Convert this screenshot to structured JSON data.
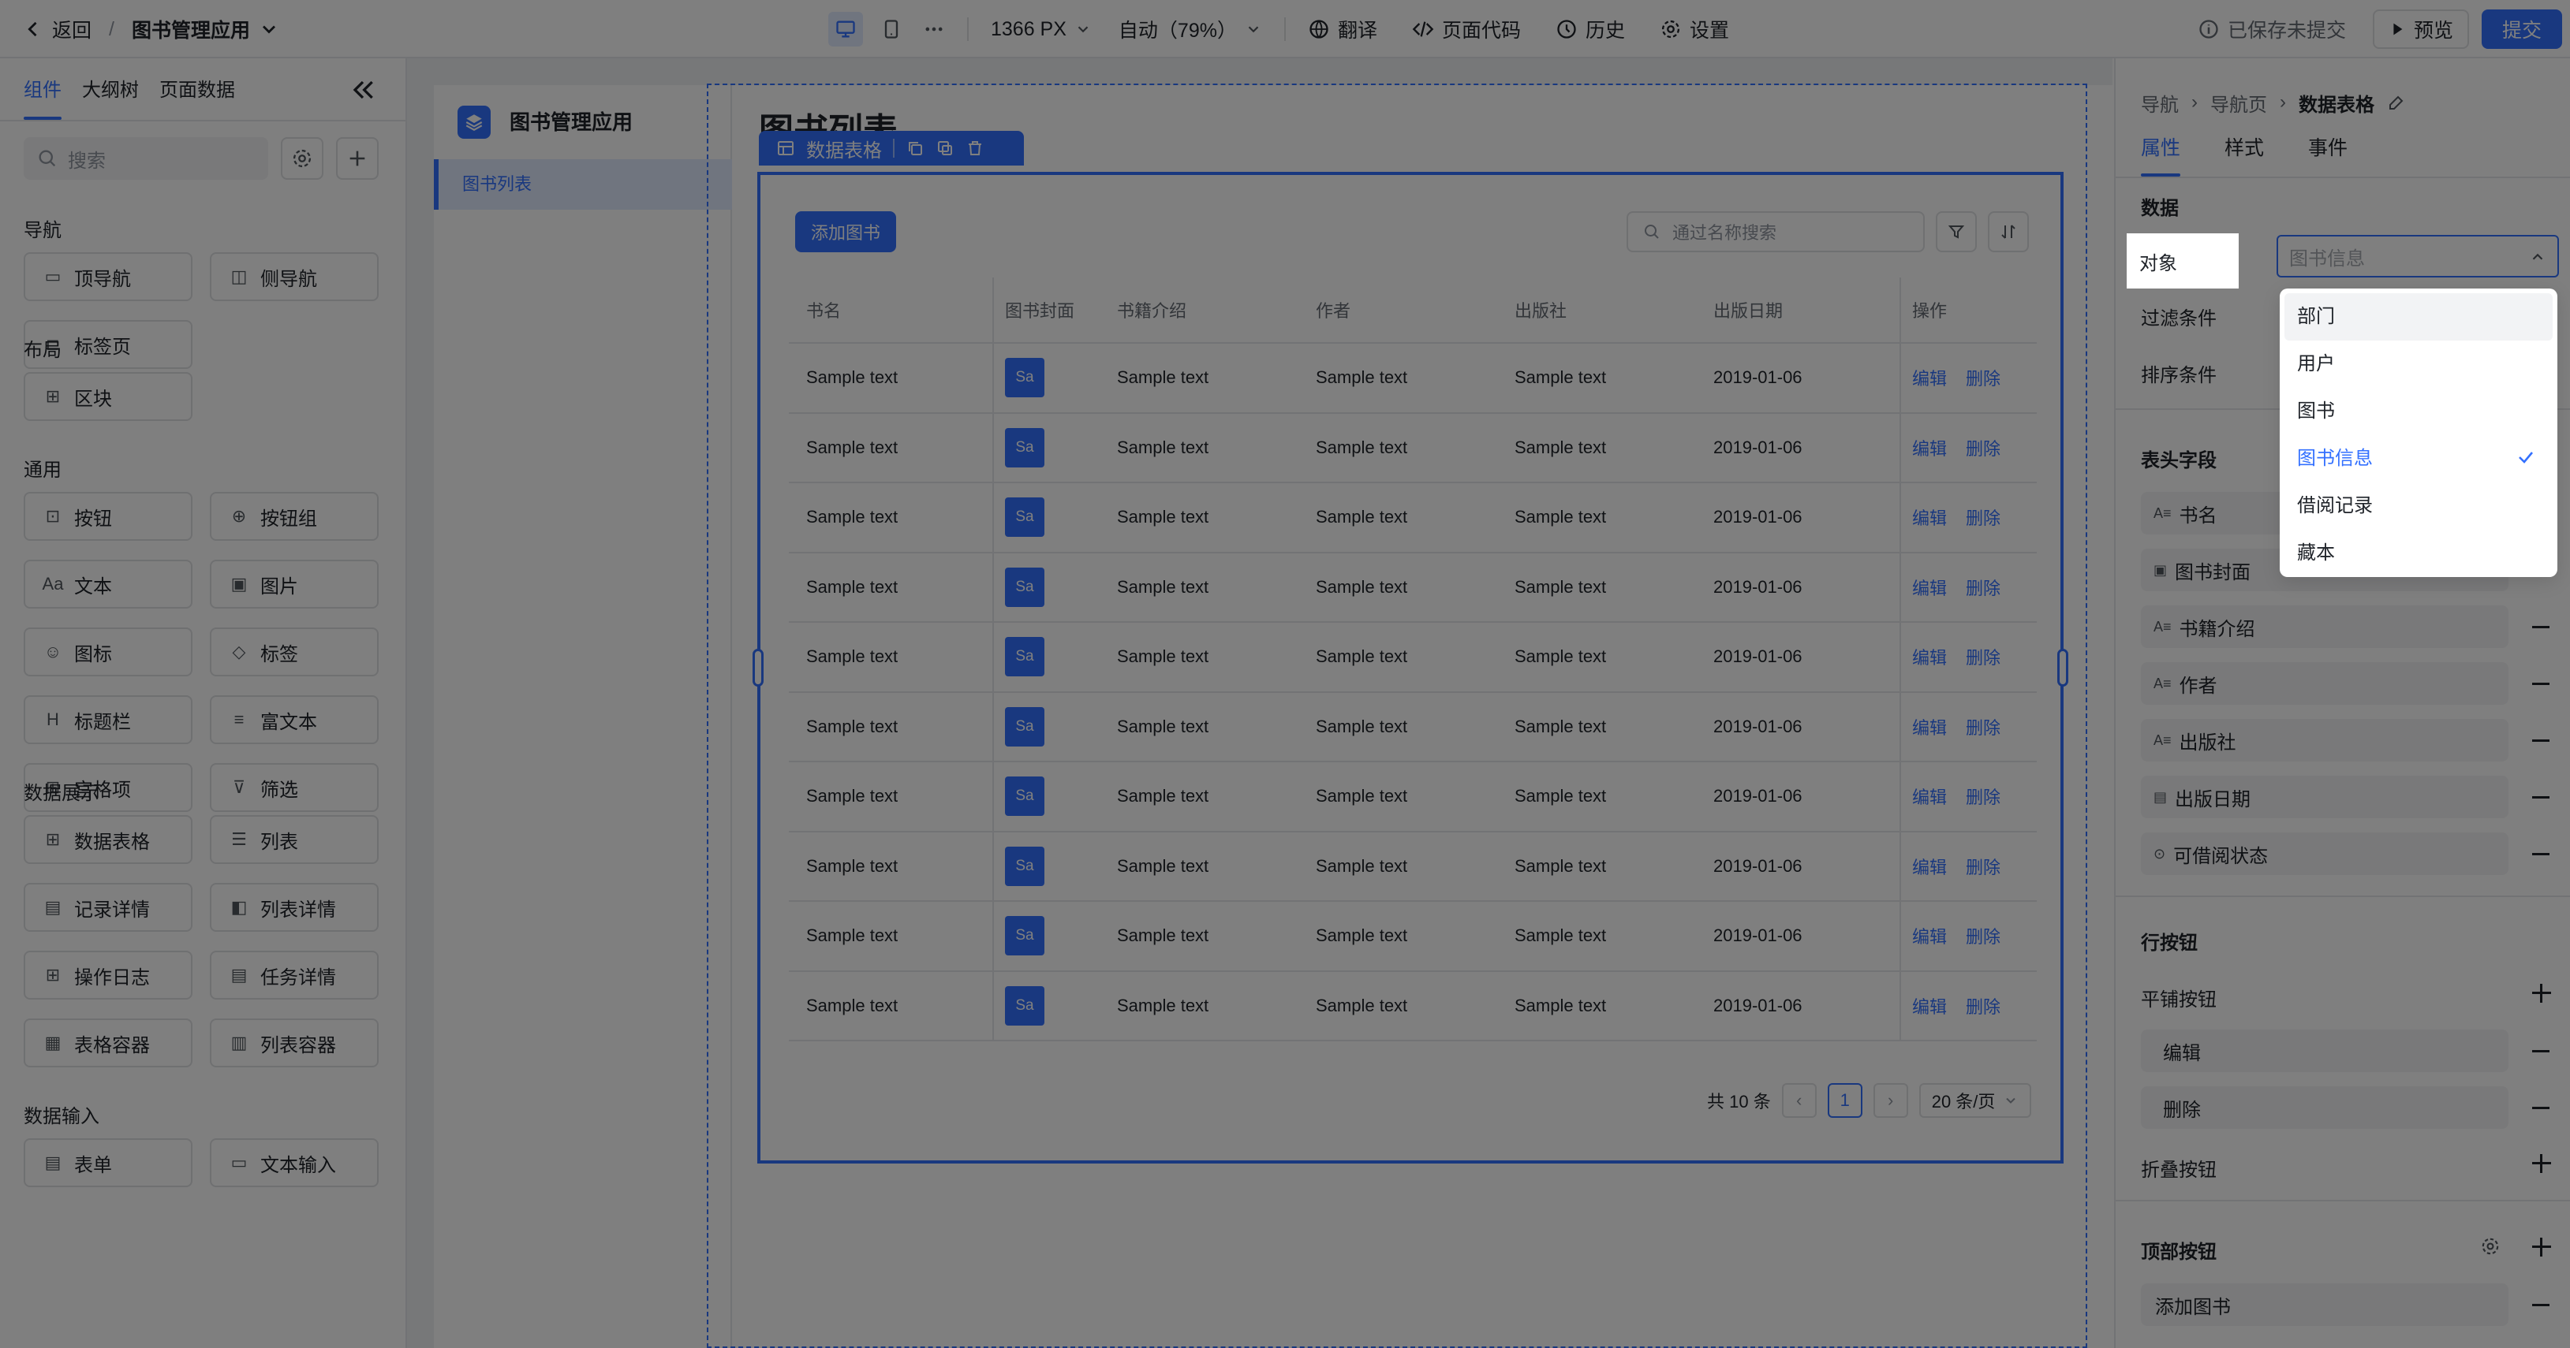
{
  "topbar": {
    "back_label": "返回",
    "app_name": "图书管理应用",
    "resolution": "1366 PX",
    "zoom": "自动（79%）",
    "translate": "翻译",
    "page_code": "页面代码",
    "history": "历史",
    "settings": "设置",
    "save_status": "已保存未提交",
    "preview": "预览",
    "submit": "提交"
  },
  "left_panel": {
    "tabs": [
      "组件",
      "大纲树",
      "页面数据"
    ],
    "search_placeholder": "搜索",
    "sections": [
      {
        "title": "导航",
        "items": [
          {
            "label": "顶导航",
            "icon": "top-nav-icon"
          },
          {
            "label": "侧导航",
            "icon": "side-nav-icon"
          },
          {
            "label": "标签页",
            "icon": "tabs-icon"
          }
        ]
      },
      {
        "title": "布局",
        "items": [
          {
            "label": "区块",
            "icon": "block-icon"
          }
        ]
      },
      {
        "title": "通用",
        "items": [
          {
            "label": "按钮",
            "icon": "button-icon"
          },
          {
            "label": "按钮组",
            "icon": "button-group-icon"
          },
          {
            "label": "文本",
            "icon": "text-icon"
          },
          {
            "label": "图片",
            "icon": "image-icon"
          },
          {
            "label": "图标",
            "icon": "smile-icon"
          },
          {
            "label": "标签",
            "icon": "tag-icon"
          },
          {
            "label": "标题栏",
            "icon": "heading-icon"
          },
          {
            "label": "富文本",
            "icon": "rich-text-icon"
          },
          {
            "label": "宫格项",
            "icon": "grid-item-icon"
          },
          {
            "label": "筛选",
            "icon": "filter-icon"
          }
        ]
      },
      {
        "title": "数据展示",
        "items": [
          {
            "label": "数据表格",
            "icon": "data-table-icon"
          },
          {
            "label": "列表",
            "icon": "list-icon"
          },
          {
            "label": "记录详情",
            "icon": "record-detail-icon"
          },
          {
            "label": "列表详情",
            "icon": "list-detail-icon"
          },
          {
            "label": "操作日志",
            "icon": "operation-log-icon"
          },
          {
            "label": "任务详情",
            "icon": "task-detail-icon"
          },
          {
            "label": "表格容器",
            "icon": "table-container-icon"
          },
          {
            "label": "列表容器",
            "icon": "list-container-icon"
          }
        ]
      },
      {
        "title": "数据输入",
        "items": [
          {
            "label": "表单",
            "icon": "form-icon"
          },
          {
            "label": "文本输入",
            "icon": "text-input-icon"
          }
        ]
      }
    ]
  },
  "canvas": {
    "app_title": "图书管理应用",
    "nav_item": "图书列表",
    "page_title": "图书列表",
    "component_name": "数据表格",
    "table": {
      "add_button": "添加图书",
      "search_placeholder": "通过名称搜索",
      "columns": [
        "书名",
        "图书封面",
        "书籍介绍",
        "作者",
        "出版社",
        "出版日期",
        "操作"
      ],
      "rows": [
        {
          "name": "Sample text",
          "cover": "Sa",
          "intro": "Sample text",
          "author": "Sample text",
          "publisher": "Sample text",
          "date": "2019-01-06",
          "edit": "编辑",
          "delete": "删除"
        },
        {
          "name": "Sample text",
          "cover": "Sa",
          "intro": "Sample text",
          "author": "Sample text",
          "publisher": "Sample text",
          "date": "2019-01-06",
          "edit": "编辑",
          "delete": "删除"
        },
        {
          "name": "Sample text",
          "cover": "Sa",
          "intro": "Sample text",
          "author": "Sample text",
          "publisher": "Sample text",
          "date": "2019-01-06",
          "edit": "编辑",
          "delete": "删除"
        },
        {
          "name": "Sample text",
          "cover": "Sa",
          "intro": "Sample text",
          "author": "Sample text",
          "publisher": "Sample text",
          "date": "2019-01-06",
          "edit": "编辑",
          "delete": "删除"
        },
        {
          "name": "Sample text",
          "cover": "Sa",
          "intro": "Sample text",
          "author": "Sample text",
          "publisher": "Sample text",
          "date": "2019-01-06",
          "edit": "编辑",
          "delete": "删除"
        },
        {
          "name": "Sample text",
          "cover": "Sa",
          "intro": "Sample text",
          "author": "Sample text",
          "publisher": "Sample text",
          "date": "2019-01-06",
          "edit": "编辑",
          "delete": "删除"
        },
        {
          "name": "Sample text",
          "cover": "Sa",
          "intro": "Sample text",
          "author": "Sample text",
          "publisher": "Sample text",
          "date": "2019-01-06",
          "edit": "编辑",
          "delete": "删除"
        },
        {
          "name": "Sample text",
          "cover": "Sa",
          "intro": "Sample text",
          "author": "Sample text",
          "publisher": "Sample text",
          "date": "2019-01-06",
          "edit": "编辑",
          "delete": "删除"
        },
        {
          "name": "Sample text",
          "cover": "Sa",
          "intro": "Sample text",
          "author": "Sample text",
          "publisher": "Sample text",
          "date": "2019-01-06",
          "edit": "编辑",
          "delete": "删除"
        },
        {
          "name": "Sample text",
          "cover": "Sa",
          "intro": "Sample text",
          "author": "Sample text",
          "publisher": "Sample text",
          "date": "2019-01-06",
          "edit": "编辑",
          "delete": "删除"
        }
      ],
      "pagination": {
        "total": "共 10 条",
        "current_page": "1",
        "page_size": "20 条/页"
      }
    }
  },
  "right_panel": {
    "breadcrumb": [
      "导航",
      "导航页",
      "数据表格"
    ],
    "tabs": [
      "属性",
      "样式",
      "事件"
    ],
    "data_section": "数据",
    "object_label": "对象",
    "object_value": "图书信息",
    "filter_label": "过滤条件",
    "sort_label": "排序条件",
    "object_options": [
      {
        "label": "部门",
        "selected": false
      },
      {
        "label": "用户",
        "selected": false
      },
      {
        "label": "图书",
        "selected": false
      },
      {
        "label": "图书信息",
        "selected": true
      },
      {
        "label": "借阅记录",
        "selected": false
      },
      {
        "label": "藏本",
        "selected": false
      }
    ],
    "header_fields_title": "表头字段",
    "header_fields": [
      {
        "label": "书名",
        "icon": "text-field-icon"
      },
      {
        "label": "图书封面",
        "icon": "image-field-icon"
      },
      {
        "label": "书籍介绍",
        "icon": "text-field-icon"
      },
      {
        "label": "作者",
        "icon": "text-field-icon"
      },
      {
        "label": "出版社",
        "icon": "text-field-icon"
      },
      {
        "label": "出版日期",
        "icon": "date-field-icon"
      },
      {
        "label": "可借阅状态",
        "icon": "status-field-icon"
      }
    ],
    "row_buttons_title": "行按钮",
    "tiled_buttons_label": "平铺按钮",
    "tiled_buttons": [
      "编辑",
      "删除"
    ],
    "collapsed_buttons_label": "折叠按钮",
    "top_buttons_title": "顶部按钮",
    "top_buttons": [
      "添加图书"
    ]
  },
  "colors": {
    "accent": "#3370ff",
    "overlay": "rgba(0,0,0,0.5)"
  }
}
